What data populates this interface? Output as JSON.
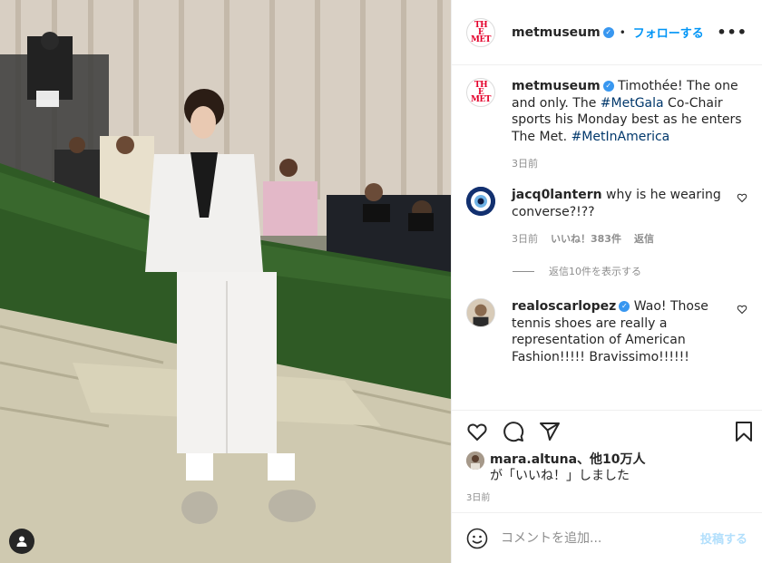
{
  "header": {
    "username": "metmuseum",
    "follow_label": "フォローする",
    "dot": "•",
    "more": "•••"
  },
  "caption": {
    "username": "metmuseum",
    "text_1": " Timothée! The one and only. The ",
    "hashtag_1": "#MetGala",
    "text_2": " Co-Chair sports his Monday best as he enters The Met. ",
    "hashtag_2": "#MetInAmerica",
    "time": "3日前"
  },
  "comments": [
    {
      "username": "jacq0lantern",
      "text": " why is he wearing converse?!??",
      "time": "3日前",
      "likes": "いいね！383件",
      "reply": "返信",
      "view_replies": "返信10件を表示する"
    },
    {
      "username": "realoscarlopez",
      "text": " Wao! Those tennis shoes are really a representation of American Fashion!!!!! Bravissimo!!!!!!"
    }
  ],
  "likes": {
    "username": "mara.altuna",
    "suffix": "、他10万人",
    "line2": "が「いいね！」しました"
  },
  "post_time": "3日前",
  "composer": {
    "placeholder": "コメントを追加...",
    "post_label": "投稿する"
  },
  "logo_text": "THE MET",
  "colors": {
    "accent": "#0095f6",
    "verified": "#3897f0",
    "met_red": "#e4002b"
  }
}
